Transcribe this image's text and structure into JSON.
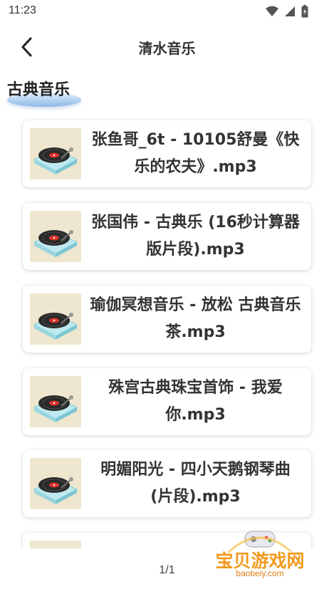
{
  "status_bar": {
    "time": "11:23"
  },
  "app_bar": {
    "title": "清水音乐"
  },
  "section": {
    "title": "古典音乐"
  },
  "songs": [
    {
      "title": "张鱼哥_6t - 10105舒曼《快乐的农夫》.mp3"
    },
    {
      "title": "张国伟 - 古典乐 (16秒计算器版片段).mp3"
    },
    {
      "title": "瑜伽冥想音乐 - 放松 古典音乐 茶.mp3"
    },
    {
      "title": "殊宫古典珠宝首饰 - 我爱你.mp3"
    },
    {
      "title": "明媚阳光 - 四小天鹅钢琴曲 (片段).mp3"
    },
    {
      "title": ""
    }
  ],
  "pager": {
    "label": "1/1"
  },
  "watermark": {
    "text": "宝贝游戏网",
    "url": "baobeiy.com"
  },
  "colors": {
    "accent_underline": "#8fb8e8",
    "watermark": "#f29a1f"
  },
  "icons": {
    "back": "chevron-left-icon",
    "thumb": "record-player-icon"
  }
}
